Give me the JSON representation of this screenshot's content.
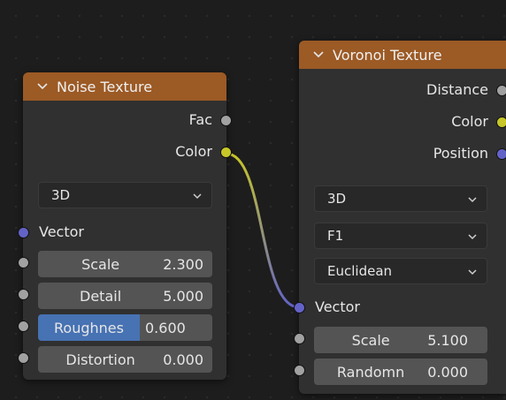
{
  "links": [
    {
      "from": "noise_texture.color",
      "to": "voronoi_texture.vector"
    }
  ],
  "noise_texture": {
    "title": "Noise Texture",
    "outputs": [
      {
        "label": "Fac",
        "socket_color": "#a1a1a1"
      },
      {
        "label": "Color",
        "socket_color": "#c7c729"
      }
    ],
    "dimensions": "3D",
    "vector_input": {
      "label": "Vector",
      "socket_color": "#6363c7"
    },
    "fields": [
      {
        "label": "Scale",
        "value": "2.300"
      },
      {
        "label": "Detail",
        "value": "5.000"
      },
      {
        "label": "Roughnes",
        "value": "0.600",
        "fill_fraction": 0.6
      },
      {
        "label": "Distortion",
        "value": "0.000"
      }
    ]
  },
  "voronoi_texture": {
    "title": "Voronoi Texture",
    "outputs": [
      {
        "label": "Distance",
        "socket_color": "#a1a1a1"
      },
      {
        "label": "Color",
        "socket_color": "#c7c729"
      },
      {
        "label": "Position",
        "socket_color": "#6363c7"
      }
    ],
    "dimensions": "3D",
    "feature": "F1",
    "distance_metric": "Euclidean",
    "vector_input": {
      "label": "Vector",
      "socket_color": "#6363c7"
    },
    "fields": [
      {
        "label": "Scale",
        "value": "5.100"
      },
      {
        "label": "Randomn",
        "value": "0.000"
      }
    ]
  }
}
